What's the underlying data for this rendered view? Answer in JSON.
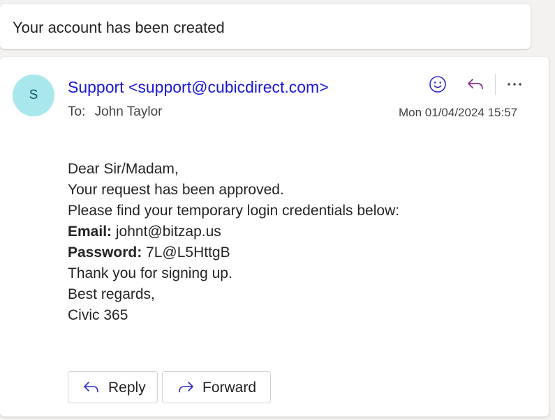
{
  "subject": "Your account has been created",
  "sender": {
    "avatar_initial": "S",
    "display": "Support <support@cubicdirect.com>"
  },
  "recipient": {
    "label": "To:",
    "name": "John Taylor"
  },
  "date": "Mon 01/04/2024 15:57",
  "icons": {
    "emoji": "smiley-icon",
    "reply": "reply-arrow-icon",
    "more": "ellipsis-icon",
    "forward": "forward-arrow-icon"
  },
  "body": {
    "greeting": "Dear Sir/Madam,",
    "line1": "Your request has been approved.",
    "line2": "Please find your temporary login credentials below:",
    "email_label": "Email:",
    "email_value": "johnt@bitzap.us",
    "password_label": "Password:",
    "password_value": "7L@L5HttgB",
    "thanks": "Thank you for signing up.",
    "closing": "Best regards,",
    "signature": "Civic 365"
  },
  "actions": {
    "reply_label": "Reply",
    "forward_label": "Forward"
  },
  "colors": {
    "sender_link": "#1a17d6",
    "avatar_bg": "#a8e8ec",
    "icon_accent": "#2b28c9",
    "reply_icon_accent": "#8a2a8c"
  }
}
